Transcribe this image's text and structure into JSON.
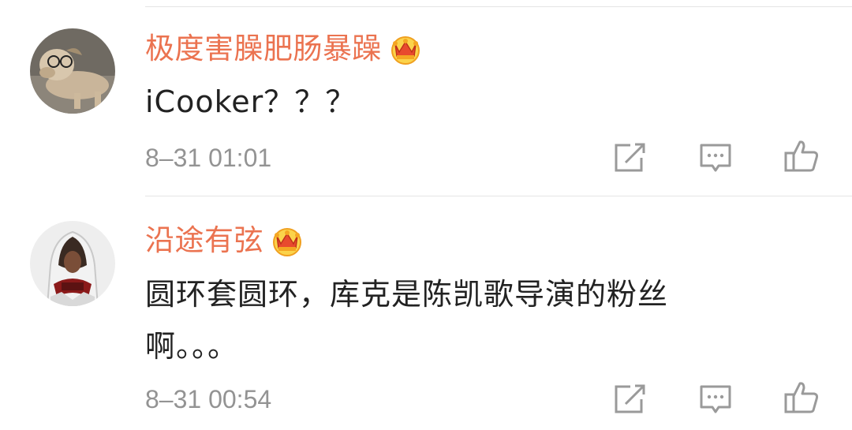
{
  "comments": [
    {
      "username": "极度害臊肥肠暴躁",
      "content": "iCooker？？？",
      "timestamp": "8–31 01:01",
      "avatar": "dog-with-glasses-avatar",
      "badge": "vip-crown-icon"
    },
    {
      "username": "沿途有弦",
      "content_line1": "圆环套圆环，库克是陈凯歌导演的粉丝",
      "content_line2": "啊。。。",
      "timestamp": "8–31 00:54",
      "avatar": "hooded-assassin-avatar",
      "badge": "vip-crown-icon"
    }
  ],
  "icons": {
    "repost": "repost-icon",
    "reply": "comment-icon",
    "like": "thumbs-up-icon"
  },
  "colors": {
    "username": "#eb7350",
    "text": "#222222",
    "meta": "#939393",
    "icon": "#9a9a9a",
    "crown": "#f4a623"
  }
}
